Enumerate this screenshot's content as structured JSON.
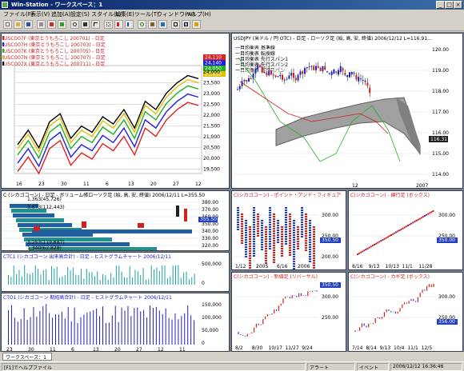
{
  "window": {
    "title": "Win-Station - ワークスペース：1"
  },
  "menu": [
    "ファイル(F)",
    "表示(V)",
    "追加(A)",
    "設定(S)",
    "スタイル(L)",
    "編集(E)",
    "ツール(T)",
    "ウィンドウ(W)",
    "ヘルプ(H)"
  ],
  "panels": {
    "corn": {
      "legend": [
        "USCO07F (東京とうもろこし 200701) - 日足",
        "USCO07H (東京とうもろこし 200703) - 日足",
        "USCO07K (東京とうもろこし 200705) - 日足",
        "USCO07N (東京とうもろこし 200707) - 日足",
        "USCO07X (東京とうもろこし 200711) - 日足"
      ],
      "legend_colors": [
        "#e02020",
        "#2020e0",
        "#20b020",
        "#e0c000",
        "#000000"
      ],
      "price_tags": [
        "24,110",
        "24,140",
        "24,050",
        "23,850"
      ],
      "yticks": [
        "24,000",
        "23,500",
        "23,000",
        "22,500",
        "22,000",
        "21,500",
        "21,000",
        "20,500",
        "20,000",
        "19,500"
      ],
      "xticks": [
        "16",
        "23",
        "30",
        "11",
        "6",
        "13",
        "20",
        "27",
        "12"
      ]
    },
    "usdjpy": {
      "title": "USDJPY (米ドル / 円 OTC) - 日足 - ローソク足 (始, 高, 安, 終値)   2006/12/12  L=116.91...",
      "legend": [
        "一目均衡表 基準線",
        "一目均衡表 転換線",
        "一目均衡表 先行スパン1",
        "一目均衡表 先行スパン2",
        "一目均衡表 遅行スパン"
      ],
      "price_tag": "116.31",
      "yticks": [
        "120.00",
        "119.00",
        "118.00",
        "117.00",
        "116.00",
        "115.00",
        "114.00"
      ],
      "xticks": [
        "12",
        "2007"
      ]
    },
    "cbot": {
      "title": "C (シカゴコーン) - 日足 - ボリューム帳ローソク足 (始, 高, 安, 終値)   2006/12/11  L=355.50",
      "volumes": [
        "1,363(45,726)",
        "3,873(112,443)",
        "3,253(119,687)",
        "1,340(62,828)"
      ],
      "price_tag": "355.50",
      "yticks": [
        "380.00",
        "370.00",
        "360.00",
        "350.00",
        "340.00",
        "330.00",
        "320.00"
      ]
    },
    "hist1": {
      "title": "CTC1 (シカゴコーン 出来高合計) - 日足 - ヒストグラムチャート   2006/12/11",
      "yticks": [
        "500,000",
        "0"
      ]
    },
    "hist2": {
      "title": "CTO1 (シカゴコーン 期組高合計) - 日足 - ヒストグラムチャート   2006/12/11",
      "yticks": [
        "150,000",
        "100,000",
        "50,000",
        "0"
      ],
      "xticks": [
        "23",
        "30",
        "11",
        "6",
        "13",
        "20",
        "27",
        "12",
        "11"
      ]
    },
    "pf": {
      "title": "C(シカゴコーン) - ポイント・アンド・フィギュア",
      "price_tag": "350.50",
      "yticks": [
        "300.00",
        "250.00",
        "200.00"
      ],
      "xticks": [
        "1/12",
        "2005",
        "6/16",
        "2006"
      ]
    },
    "kagi": {
      "title": "C(シカゴコーン) - 新値足 (リバーサル)",
      "price_tag": "350.50",
      "yticks": [
        "300.00",
        "250.00"
      ],
      "xticks": [
        "8/2",
        "8/30",
        "10/17",
        "11/27",
        "9/24"
      ]
    },
    "renko": {
      "title": "C(シカゴコーン) - 練行足 (ボックス)",
      "price_tag": "350.00",
      "yticks": [
        "300.00",
        "250.00"
      ],
      "xticks": [
        "8/16",
        "9/13",
        "10/13",
        "11/1",
        "11/28"
      ]
    },
    "kagi2": {
      "title": "C(シカゴコーン) - カギ足 (ボックス)",
      "price_tag": "356.00",
      "yticks": [
        "300.00",
        "250.00"
      ],
      "xticks": [
        "7/14",
        "8/14",
        "9/13",
        "10/4",
        "11/1",
        "12/5"
      ]
    }
  },
  "tabs": {
    "active": "ワークスペース：1"
  },
  "status": {
    "help": "[F1]でヘルプファイル",
    "alert": "アラート",
    "event": "イベント",
    "datetime": "2006/12/12 16:36:46"
  }
}
